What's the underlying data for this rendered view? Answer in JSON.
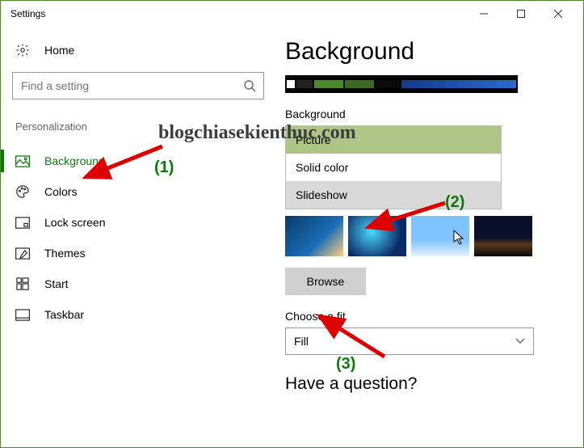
{
  "window": {
    "title": "Settings"
  },
  "sidebar": {
    "home": "Home",
    "search_placeholder": "Find a setting",
    "section": "Personalization",
    "items": [
      {
        "label": "Background"
      },
      {
        "label": "Colors"
      },
      {
        "label": "Lock screen"
      },
      {
        "label": "Themes"
      },
      {
        "label": "Start"
      },
      {
        "label": "Taskbar"
      }
    ]
  },
  "main": {
    "title": "Background",
    "bg_label": "Background",
    "options": {
      "picture": "Picture",
      "solid": "Solid color",
      "slideshow": "Slideshow"
    },
    "browse": "Browse",
    "fit_label": "Choose a fit",
    "fit_value": "Fill",
    "question": "Have a question?"
  },
  "annotations": {
    "watermark": "blogchiasekienthuc.com",
    "n1": "(1)",
    "n2": "(2)",
    "n3": "(3)"
  }
}
